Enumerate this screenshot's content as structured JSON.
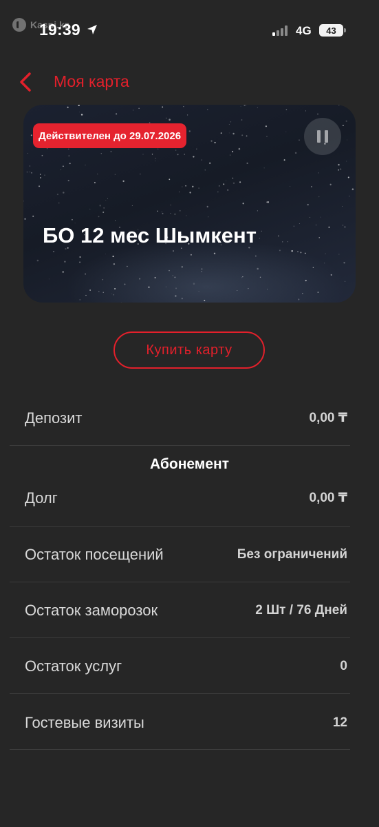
{
  "status_bar": {
    "watermark": "Kaspi.kz",
    "time": "19:39",
    "network": "4G",
    "battery": "43"
  },
  "header": {
    "title": "Моя карта"
  },
  "card": {
    "valid_until": "Действителен до 29.07.2026",
    "name": "БО 12 мес Шымкент"
  },
  "buy_button": {
    "label": "Купить карту"
  },
  "rows": {
    "deposit": {
      "label": "Депозит",
      "value": "0,00 ₸"
    },
    "section_title": "Абонемент",
    "debt": {
      "label": "Долг",
      "value": "0,00 ₸"
    },
    "visits_left": {
      "label": "Остаток посещений",
      "value": "Без ограничений"
    },
    "freezes_left": {
      "label": "Остаток заморозок",
      "value": "2 Шт / 76 Дней"
    },
    "services_left": {
      "label": "Остаток услуг",
      "value": "0"
    },
    "guest_visits": {
      "label": "Гостевые визиты",
      "value": "12"
    }
  },
  "colors": {
    "accent": "#e3202b",
    "background": "#262626",
    "badge": "#e5232f"
  },
  "icons": {
    "back": "chevron-left-icon",
    "location": "location-arrow-icon",
    "signal": "signal-bars-icon",
    "pause": "pause-icon"
  }
}
